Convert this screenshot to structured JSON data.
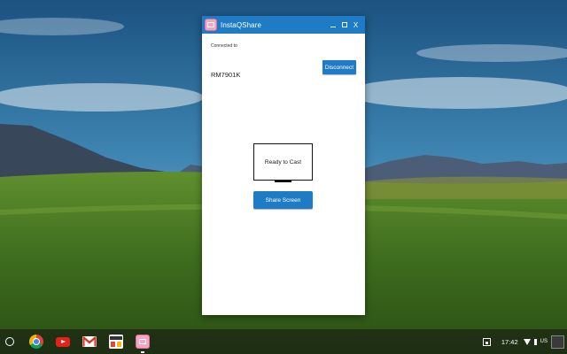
{
  "window": {
    "title": "InstaQShare",
    "title_icon": "instaqshare-icon",
    "controls": {
      "minimize": "minimize-icon",
      "maximize": "maximize-icon",
      "close_label": "X"
    }
  },
  "connection": {
    "label": "Connected to",
    "device": "RM7901K",
    "disconnect_label": "Disconnect"
  },
  "cast": {
    "status": "Ready to Cast",
    "share_label": "Share Screen"
  },
  "shelf": {
    "apps": [
      "launcher-icon",
      "chrome-icon",
      "youtube-icon",
      "gmail-icon",
      "photos-icon",
      "instaqshare-icon"
    ],
    "tray": {
      "time": "17:42",
      "ime": "US"
    }
  },
  "colors": {
    "accent": "#1f7bc4",
    "app_icon": "#f2a7c1"
  }
}
